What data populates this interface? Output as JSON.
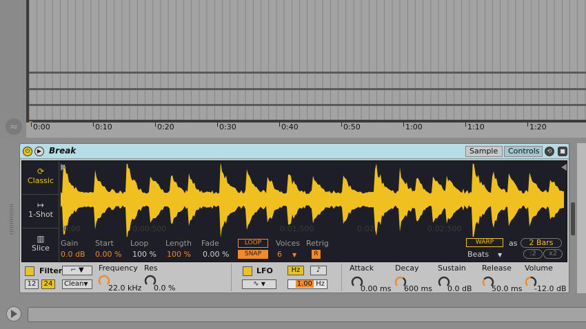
{
  "arrangement": {
    "ruler_labels": [
      "0:00",
      "0:10",
      "0:20",
      "0:30",
      "0:40",
      "0:50",
      "1:00",
      "1:10",
      "1:20"
    ]
  },
  "device": {
    "title": "Break",
    "tabs": {
      "sample": "Sample",
      "controls": "Controls"
    },
    "modes": {
      "classic": "Classic",
      "oneshot": "1-Shot",
      "slice": "Slice"
    },
    "time_labels": [
      "0:00",
      "0:00:500",
      "0:01:500",
      "0:02",
      "0:02:500"
    ],
    "params": {
      "gain_label": "Gain",
      "gain_value": "0.0 dB",
      "start_label": "Start",
      "start_value": "0.00 %",
      "loop_label": "Loop",
      "loop_value": "100 %",
      "length_label": "Length",
      "length_value": "100 %",
      "fade_label": "Fade",
      "fade_value": "0.00 %",
      "loop_btn": "LOOP",
      "snap_btn": "SNAP",
      "voices_label": "Voices",
      "voices_value": "6",
      "retrig_label": "Retrig",
      "retrig_btn": "R"
    },
    "warp": {
      "warp_btn": "WARP",
      "as_label": "as",
      "bars": "2 Bars",
      "mode": "Beats",
      "half": ":2",
      "double": "x2"
    },
    "filter": {
      "label": "Filter",
      "slope_12": "12",
      "slope_24": "24",
      "type": "Clean",
      "frequency_label": "Frequency",
      "frequency_value": "22.0 kHz",
      "res_label": "Res",
      "res_value": "0.0 %"
    },
    "lfo": {
      "label": "LFO",
      "hz_btn": "Hz",
      "note_btn": "♪",
      "rate_value": "1.00",
      "rate_unit": "Hz"
    },
    "envelope": {
      "attack_label": "Attack",
      "attack_value": "0.00 ms",
      "decay_label": "Decay",
      "decay_value": "600 ms",
      "sustain_label": "Sustain",
      "sustain_value": "0.0 dB",
      "release_label": "Release",
      "release_value": "50.0 ms",
      "volume_label": "Volume",
      "volume_value": "-12.0 dB"
    },
    "colors": {
      "header": "#b6dde5",
      "accent": "#f0c020",
      "orange": "#f08a2a",
      "display_bg": "#1e1f26"
    }
  }
}
